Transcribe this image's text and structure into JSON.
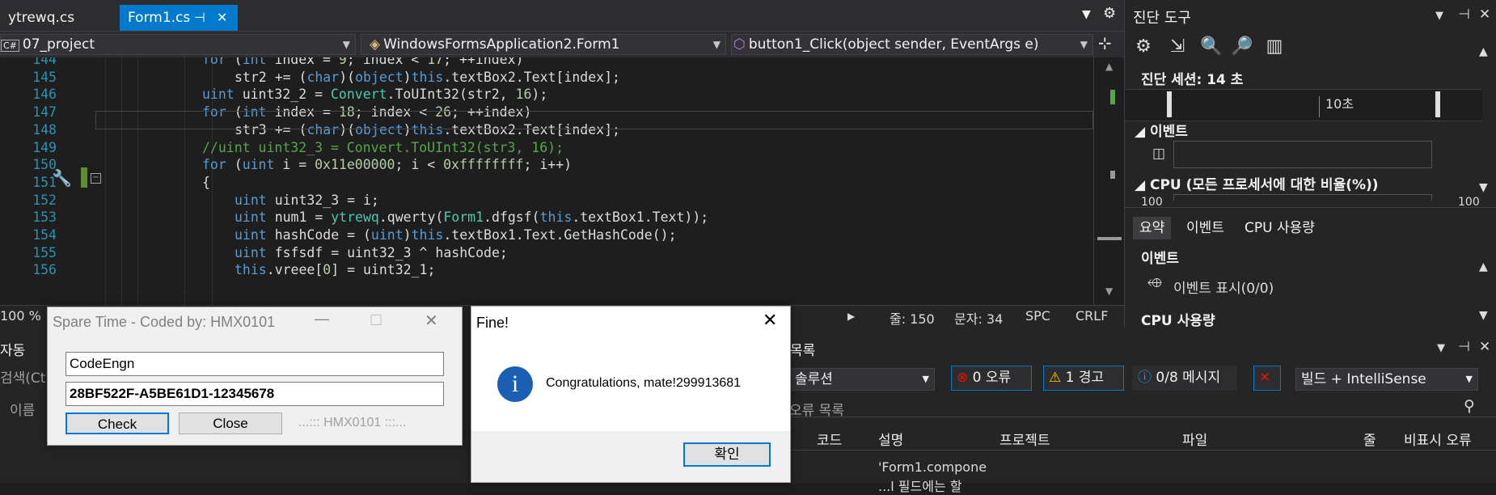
{
  "tabs": [
    {
      "label": "ytrewq.cs",
      "active": false
    },
    {
      "label": "Form1.cs",
      "active": true
    }
  ],
  "tab_icons": {
    "pin": "⊣",
    "close": "✕"
  },
  "navbar": {
    "project_badge": "C#",
    "project": "07_project",
    "class": "WindowsFormsApplication2.Form1",
    "member": "button1_Click(object sender, EventArgs e)"
  },
  "code_lines": [
    {
      "num": "144",
      "text": "for (int index = 9; index < 17; ++index)"
    },
    {
      "num": "145",
      "text": "    str2 += (char)(object)this.textBox2.Text[index];"
    },
    {
      "num": "146",
      "text": "uint uint32_2 = Convert.ToUInt32(str2, 16);"
    },
    {
      "num": "147",
      "text": "for (int index = 18; index < 26; ++index)"
    },
    {
      "num": "148",
      "text": "    str3 += (char)(object)this.textBox2.Text[index];"
    },
    {
      "num": "149",
      "text": "//uint uint32_3 = Convert.ToUInt32(str3, 16);"
    },
    {
      "num": "150",
      "text": "for (uint i = 0x11e00000; i < 0xffffffff; i++)"
    },
    {
      "num": "151",
      "text": "{"
    },
    {
      "num": "152",
      "text": "    uint uint32_3 = i;"
    },
    {
      "num": "153",
      "text": "    uint num1 = ytrewq.qwerty(Form1.dfgsf(this.textBox1.Text));"
    },
    {
      "num": "154",
      "text": "    uint hashCode = (uint)this.textBox1.Text.GetHashCode();"
    },
    {
      "num": "155",
      "text": "    uint fsfsdf = uint32_3 ^ hashCode;"
    },
    {
      "num": "156",
      "text": "    this.vreee[0] = uint32_1;"
    }
  ],
  "status": {
    "zoom": "100 %",
    "line": "줄: 150",
    "char": "문자: 34",
    "spc": "SPC",
    "crlf": "CRLF"
  },
  "diag": {
    "title": "진단 도구",
    "session": "진단 세션: 14 초",
    "timeline_label": "10초",
    "events_header": "◢ 이벤트",
    "cpu_header": "◢ CPU (모든 프로세서에 대한 비율(%))",
    "cpu_left": "100",
    "cpu_right": "100",
    "tabs": [
      "요약",
      "이벤트",
      "CPU 사용량"
    ],
    "section_events": "이벤트",
    "show_events": "이벤트 표시(0/0)",
    "section_cpu": "CPU 사용량",
    "icons": [
      "gear-icon",
      "export-icon",
      "zoom-in-icon",
      "zoom-out-icon",
      "chart-icon"
    ]
  },
  "bottom": {
    "left_title": "자동",
    "left_search": "검색(Ct",
    "left_col": "이름",
    "panel_title": "목록",
    "panel_title_full": "오류 목록",
    "scope": "솔루션",
    "errors": "0 오류",
    "warnings": "1 경고",
    "messages": "0/8 메시지",
    "build": "빌드 + IntelliSense",
    "columns": [
      "코드",
      "설명",
      "프로젝트",
      "파일",
      "줄",
      "비표시 오류"
    ],
    "row_desc_1": "'Form1.compone",
    "row_desc_2": "...l 필드에는 할"
  },
  "spare_dialog": {
    "title": "Spare Time - Coded by: HMX0101",
    "name_value": "CodeEngn",
    "serial_value": "28BF522F-A5BE61D1-12345678",
    "check": "Check",
    "close": "Close",
    "brand": "...::: HMX0101 :::..."
  },
  "fine_dialog": {
    "title": "Fine!",
    "message": "Congratulations, mate!299913681",
    "ok": "확인",
    "accent": "#1a5fb4"
  },
  "colors": {
    "accent": "#007acc",
    "background": "#1e1e1e"
  }
}
